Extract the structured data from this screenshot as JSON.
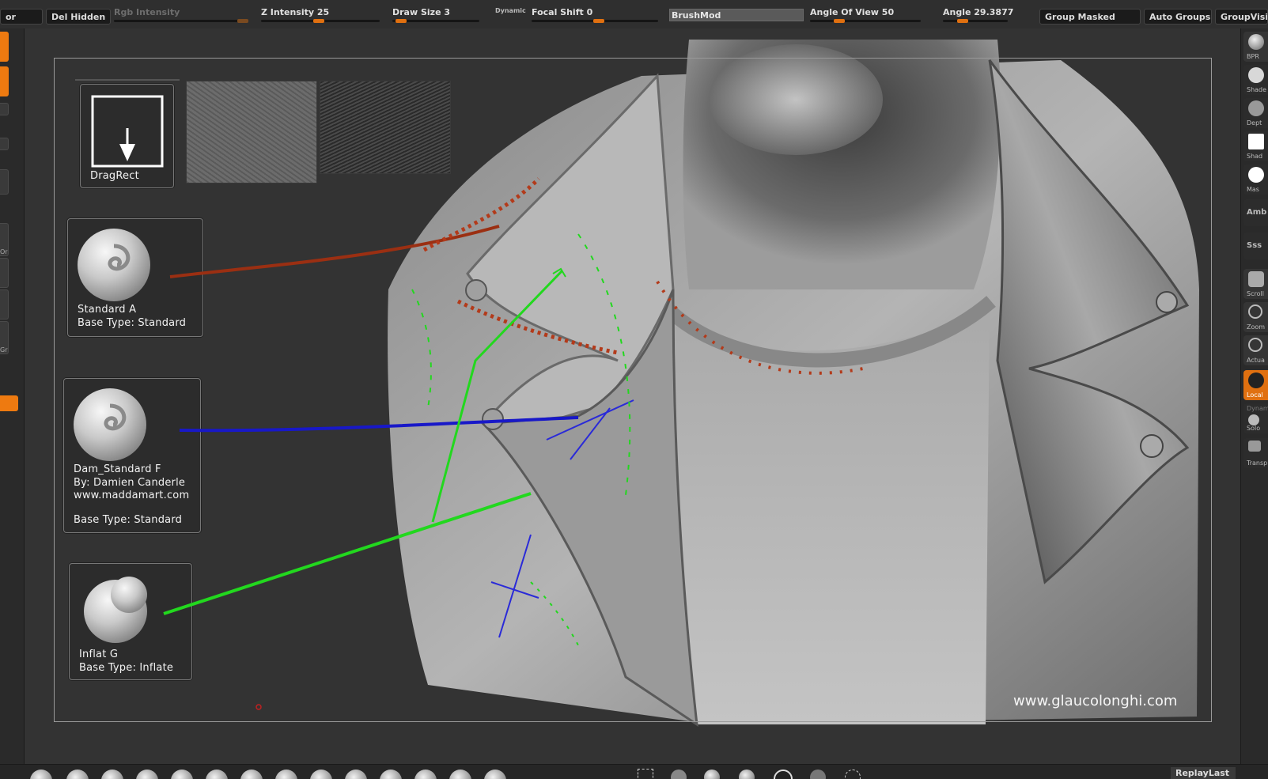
{
  "topbar": {
    "left_cut": "or",
    "del_hidden": "Del Hidden",
    "rgb_intensity": "Rgb Intensity",
    "z_intensity": "Z Intensity 25",
    "draw_size": "Draw Size 3",
    "dynamic": "Dynamic",
    "focal_shift": "Focal Shift 0",
    "brushmod": "BrushMod",
    "angle_of_view": "Angle Of View 50",
    "angle": "Angle 29.3877",
    "group_masked": "Group Masked",
    "auto_groups": "Auto Groups",
    "group_visible": "GroupVisibl"
  },
  "rightbar": {
    "bpr": "BPR",
    "shade1": "Shade",
    "depth": "Dept",
    "shade2": "Shad",
    "mask": "Mas",
    "amb": "Amb",
    "sss": "Sss",
    "scroll": "Scroll",
    "zoom": "Zoom",
    "actual": "Actua",
    "local": "Local",
    "dynamic": "Dynam",
    "solo": "Solo",
    "transp": "Transp"
  },
  "leftbar": {
    "or_label": "Or",
    "gr_label": "Gr"
  },
  "cards": {
    "dragrect": {
      "label": "DragRect"
    },
    "standard": {
      "name": "Standard  A",
      "base": "Base Type: Standard"
    },
    "dam": {
      "name": "Dam_Standard  F",
      "by": "By: Damien Canderle",
      "url": "www.maddamart.com",
      "base": "Base Type: Standard"
    },
    "inflat": {
      "name": "Inflat  G",
      "base": "Base Type: Inflate"
    }
  },
  "watermark": "www.glaucolonghi.com",
  "bottombar": {
    "replay": "ReplayLast"
  },
  "colors": {
    "accent": "#e07010",
    "red_stroke": "#b33a1a",
    "blue_stroke": "#1a1ad0",
    "green_stroke": "#22d81e"
  }
}
